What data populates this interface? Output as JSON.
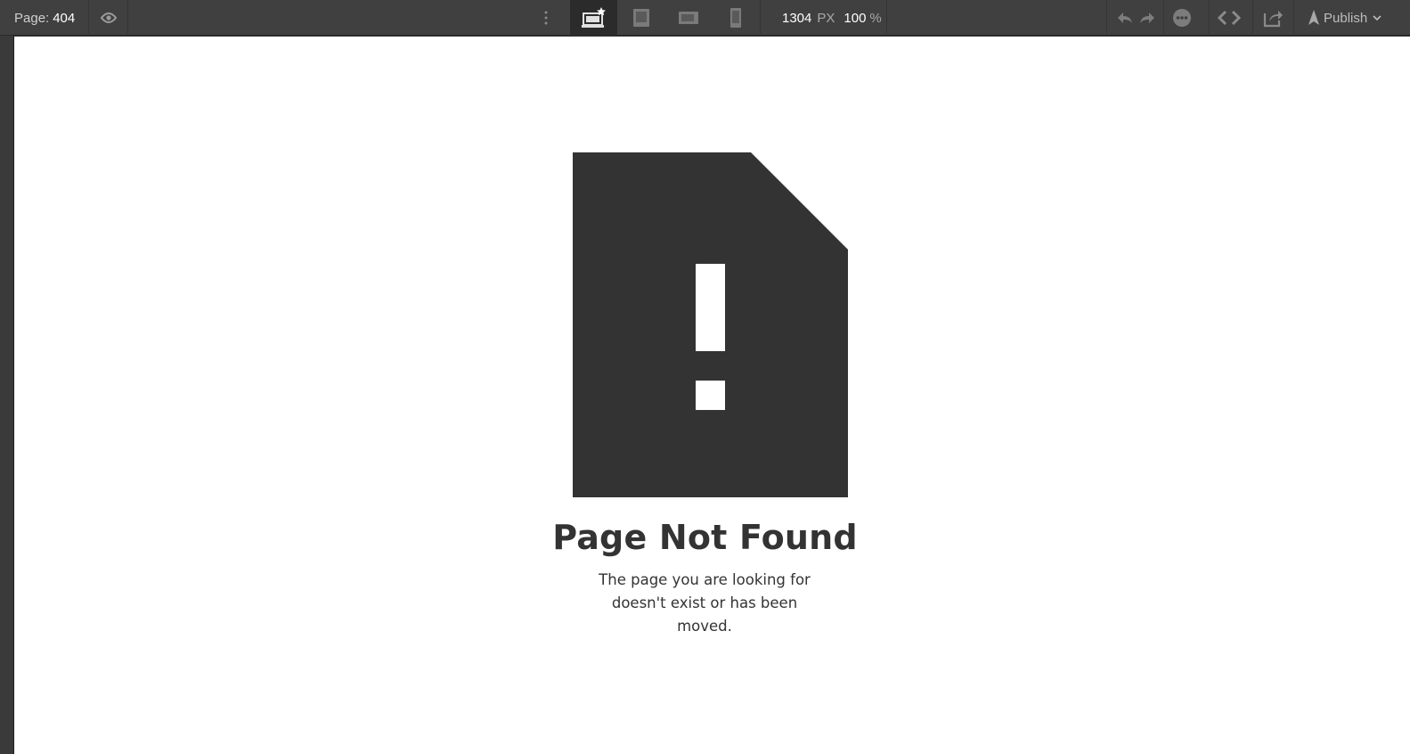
{
  "toolbar": {
    "page_label": "Page:",
    "page_value": "404",
    "width_value": "1304",
    "width_unit": "PX",
    "zoom_value": "100",
    "zoom_unit": "%",
    "publish_label": "Publish",
    "icons": [
      "eye-icon",
      "more-vertical-icon",
      "desktop-device-icon",
      "tablet-device-icon",
      "tablet-landscape-device-icon",
      "phone-device-icon",
      "undo-icon",
      "redo-icon",
      "chat-icon",
      "code-icon",
      "share-icon",
      "rocket-icon",
      "chevron-down-icon"
    ],
    "active_device": "desktop"
  },
  "canvas": {
    "title": "Page Not Found",
    "message": "The page you are looking for doesn't exist or has been moved.",
    "icon": "file-error-icon"
  },
  "colors": {
    "toolbar_bg": "#404040",
    "canvas_bg": "#ffffff",
    "text_dark": "#333333"
  }
}
